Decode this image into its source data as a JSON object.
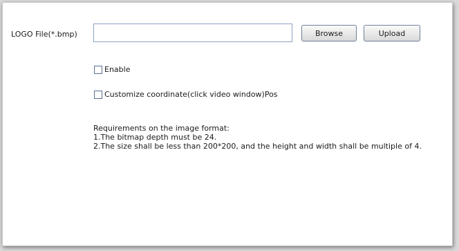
{
  "logo": {
    "label": "LOGO File(*.bmp)",
    "input_value": "",
    "browse_label": "Browse",
    "upload_label": "Upload"
  },
  "options": {
    "enable_label": "Enable",
    "enable_checked": false,
    "coordinate_label": "Customize coordinate(click video window)Pos",
    "coordinate_checked": false
  },
  "requirements": {
    "heading": "Requirements on the image format:",
    "lines": [
      "1.The bitmap depth must be 24.",
      "2.The size shall be less than 200*200, and the height and width shall be multiple of 4."
    ]
  }
}
